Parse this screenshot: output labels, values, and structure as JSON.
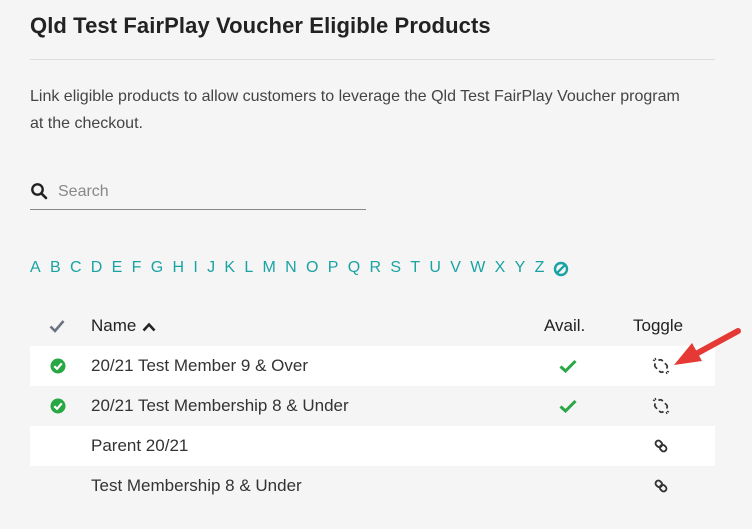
{
  "header": {
    "title": "Qld Test FairPlay Voucher Eligible Products"
  },
  "description": "Link eligible products to allow customers to leverage the Qld Test FairPlay Voucher program at the checkout.",
  "search": {
    "placeholder": "Search",
    "value": ""
  },
  "alphabet": [
    "A",
    "B",
    "C",
    "D",
    "E",
    "F",
    "G",
    "H",
    "I",
    "J",
    "K",
    "L",
    "M",
    "N",
    "O",
    "P",
    "Q",
    "R",
    "S",
    "T",
    "U",
    "V",
    "W",
    "X",
    "Y",
    "Z"
  ],
  "table": {
    "columns": {
      "name": "Name",
      "avail": "Avail.",
      "toggle": "Toggle"
    },
    "rows": [
      {
        "name": "20/21 Test Member 9 & Over",
        "linked": true,
        "available": true,
        "toggle_icon": "unlink-icon"
      },
      {
        "name": "20/21 Test Membership 8 & Under",
        "linked": true,
        "available": true,
        "toggle_icon": "unlink-icon"
      },
      {
        "name": "Parent 20/21",
        "linked": false,
        "available": false,
        "toggle_icon": "link-icon"
      },
      {
        "name": "Test Membership 8 & Under",
        "linked": false,
        "available": false,
        "toggle_icon": "link-icon"
      }
    ]
  },
  "colors": {
    "accent": "#1aa3a3",
    "success": "#28a745",
    "arrow": "#e53935"
  }
}
